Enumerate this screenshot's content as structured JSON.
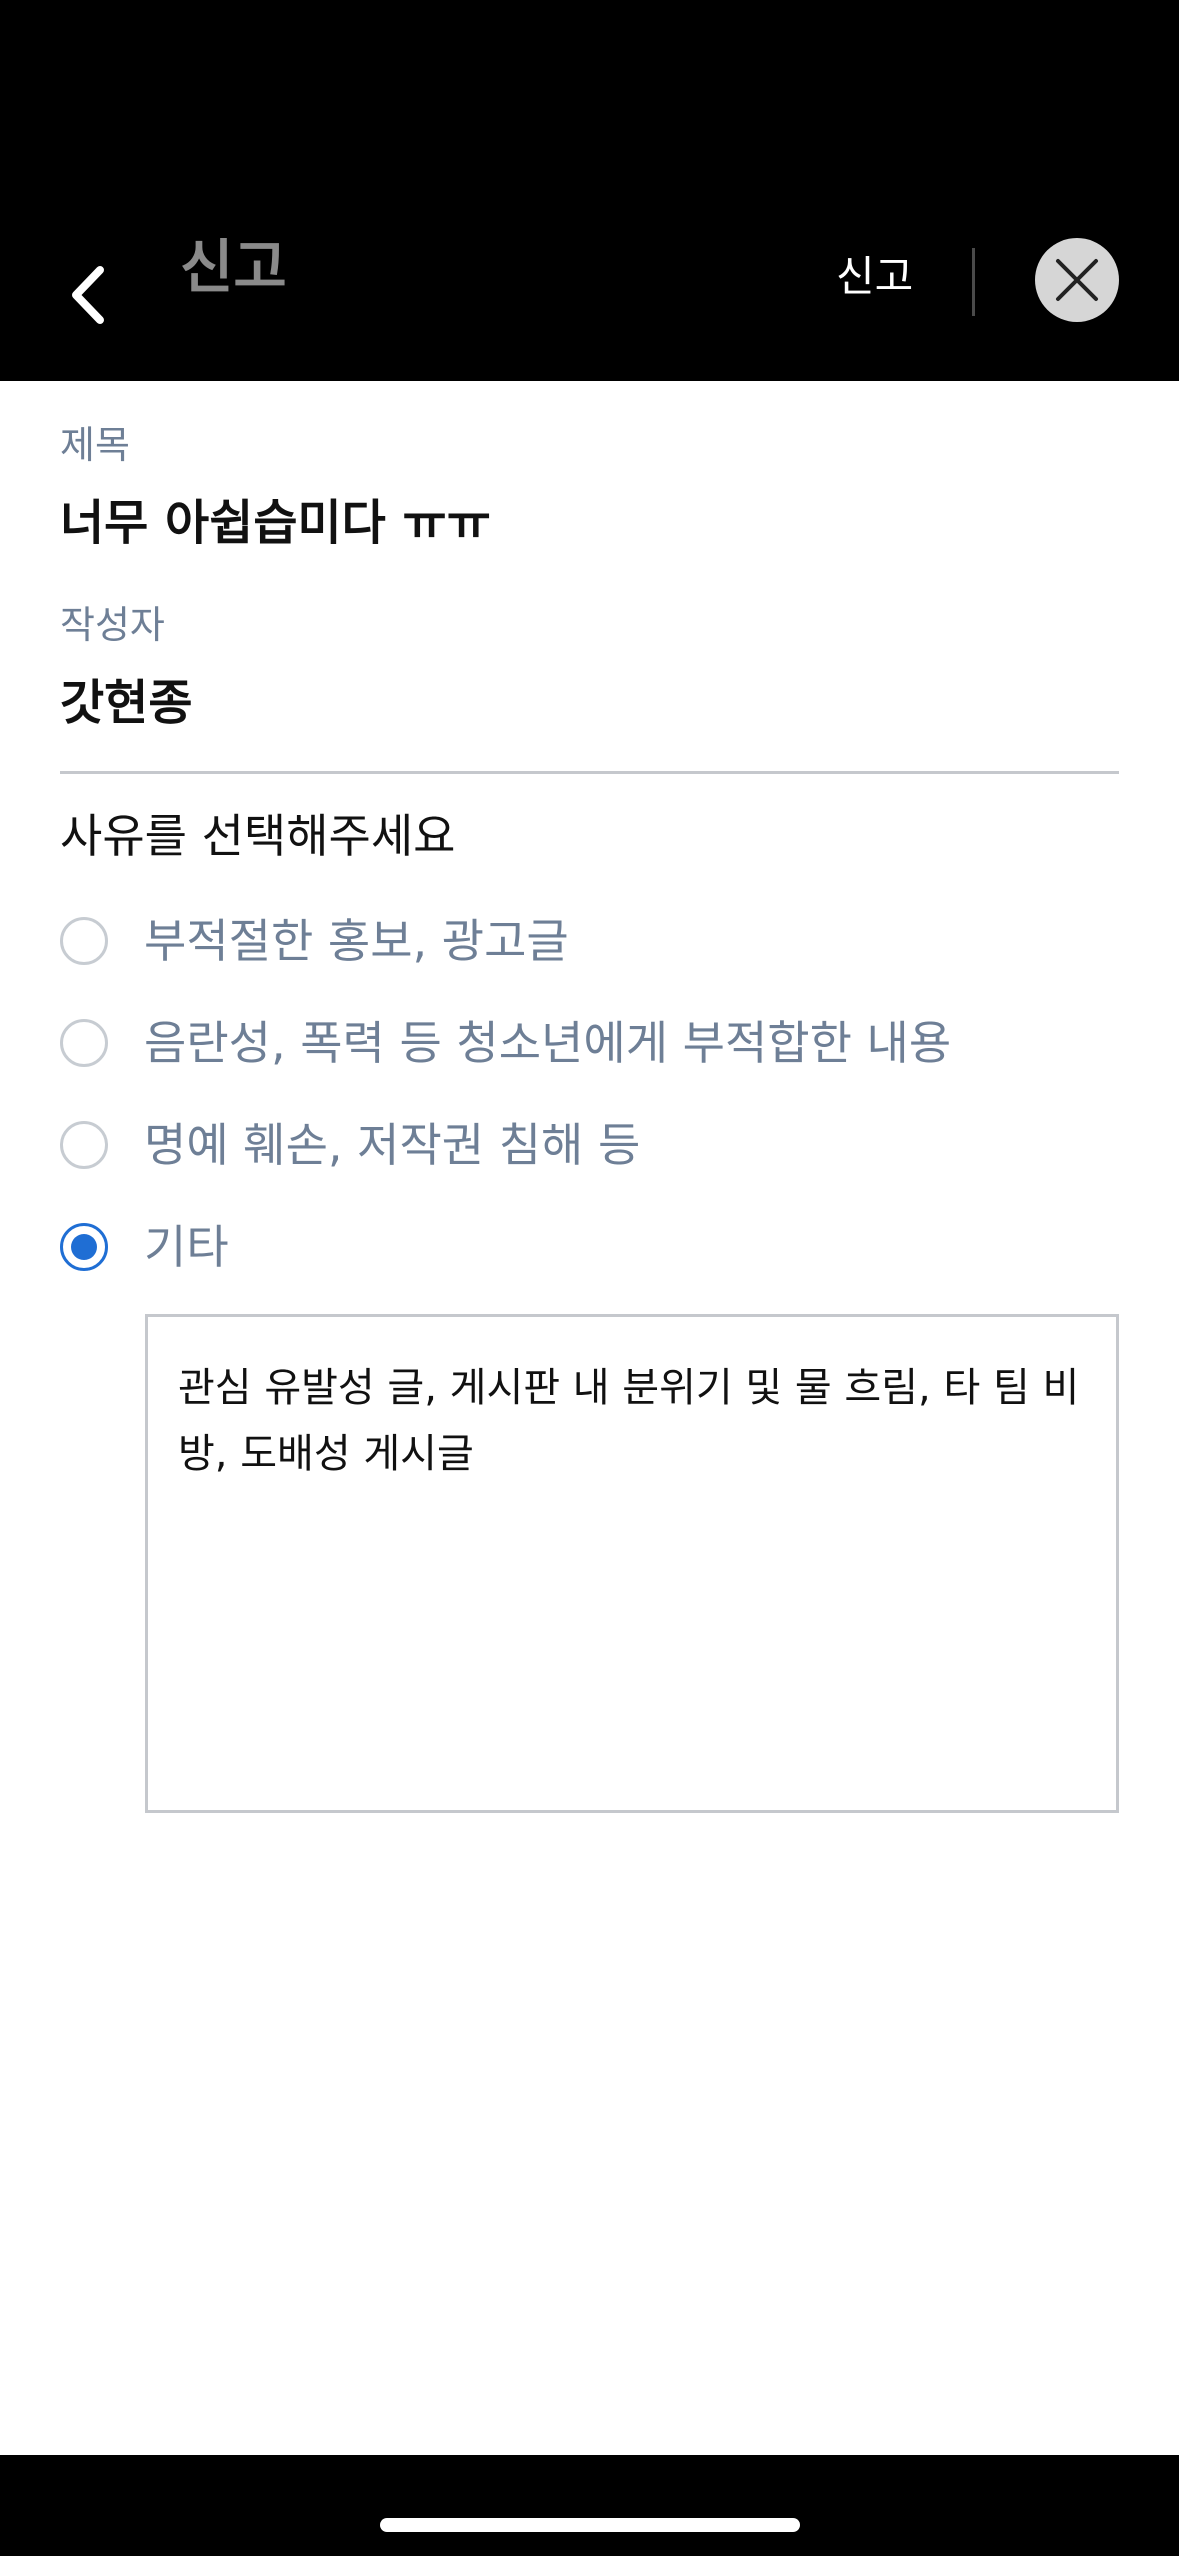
{
  "header": {
    "title": "신고",
    "report_label": "신고",
    "back_icon": "chevron-left-icon",
    "close_icon": "close-icon"
  },
  "form": {
    "title_label": "제목",
    "title_value": "너무 아쉽습미다 ㅠㅠ",
    "author_label": "작성자",
    "author_value": "갓현종",
    "reason_heading": "사유를 선택해주세요",
    "options": [
      {
        "label": "부적절한 홍보, 광고글",
        "selected": false
      },
      {
        "label": "음란성, 폭력 등 청소년에게 부적합한 내용",
        "selected": false
      },
      {
        "label": "명예 훼손, 저작권 침해 등",
        "selected": false
      },
      {
        "label": "기타",
        "selected": true
      }
    ],
    "other_text": "관심 유발성 글, 게시판 내 분위기 및 물 흐림, 타 팀 비방, 도배성 게시글"
  },
  "colors": {
    "accent": "#1f6ed4",
    "label_gray": "#6e7f96",
    "header_bg": "#000000",
    "title_gray": "#8a8a8a"
  }
}
